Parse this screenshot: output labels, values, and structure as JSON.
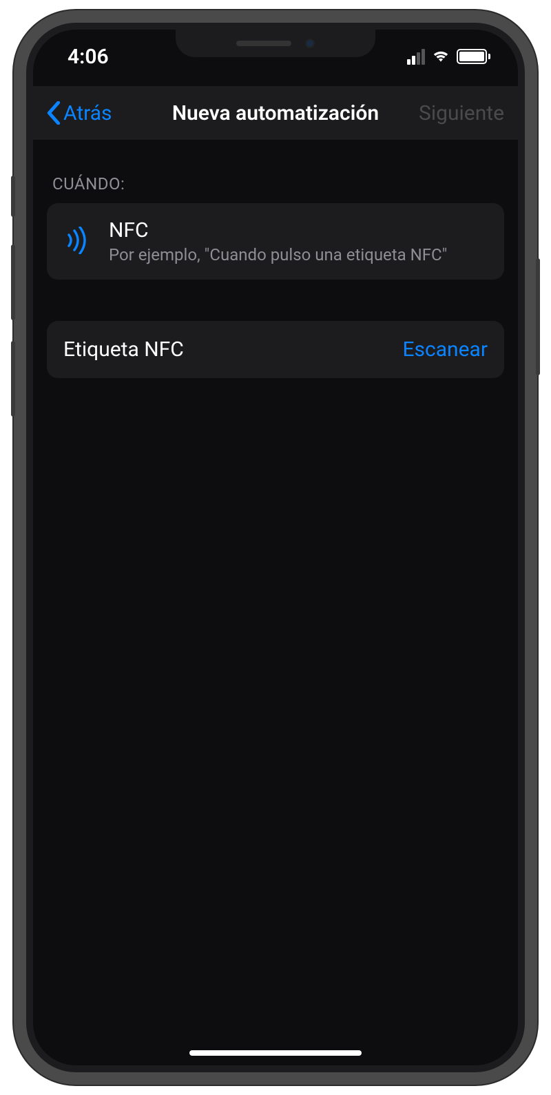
{
  "status": {
    "time": "4:06"
  },
  "nav": {
    "back": "Atrás",
    "title": "Nueva automatización",
    "next": "Siguiente"
  },
  "section": {
    "label": "CUÁNDO:"
  },
  "nfc_card": {
    "title": "NFC",
    "subtitle": "Por ejemplo, \"Cuando pulso una etiqueta NFC\""
  },
  "tag_row": {
    "label": "Etiqueta NFC",
    "action": "Escanear"
  }
}
